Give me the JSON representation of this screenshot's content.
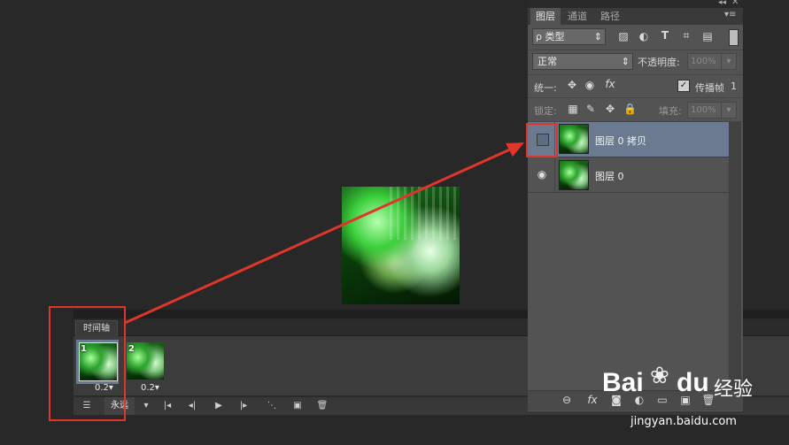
{
  "layers_panel": {
    "tabs": [
      "图层",
      "通道",
      "路径"
    ],
    "active_tab": 0,
    "filter_kind": "ρ 类型",
    "blend_mode": "正常",
    "opacity_label": "不透明度:",
    "opacity_value": "100%",
    "unify_label": "统一:",
    "propagate_label": "传播帧",
    "propagate_value": "1",
    "lock_label": "锁定:",
    "fill_label": "填充:",
    "fill_value": "100%",
    "layers": [
      {
        "name": "图层 0 拷贝",
        "visible": false,
        "selected": true
      },
      {
        "name": "图层 0",
        "visible": true,
        "selected": false
      }
    ]
  },
  "timeline": {
    "tab_label": "时间轴",
    "frames": [
      {
        "number": "1",
        "delay": "0.2▾",
        "selected": true
      },
      {
        "number": "2",
        "delay": "0.2▾",
        "selected": false
      }
    ],
    "loop_value": "永远",
    "icons": [
      "convert-icon",
      "loop-dropdown-icon",
      "first-frame-icon",
      "prev-frame-icon",
      "play-icon",
      "next-frame-icon",
      "tween-icon",
      "duplicate-frame-icon",
      "delete-frame-icon"
    ]
  },
  "watermark": {
    "brand": "Bai",
    "brand2": "du",
    "jingyan": "经验",
    "url": "jingyan.baidu.com"
  },
  "colors": {
    "annotation_red": "#e0352b",
    "selected_layer": "#6b7a91",
    "canvas_bg": "#282828"
  }
}
